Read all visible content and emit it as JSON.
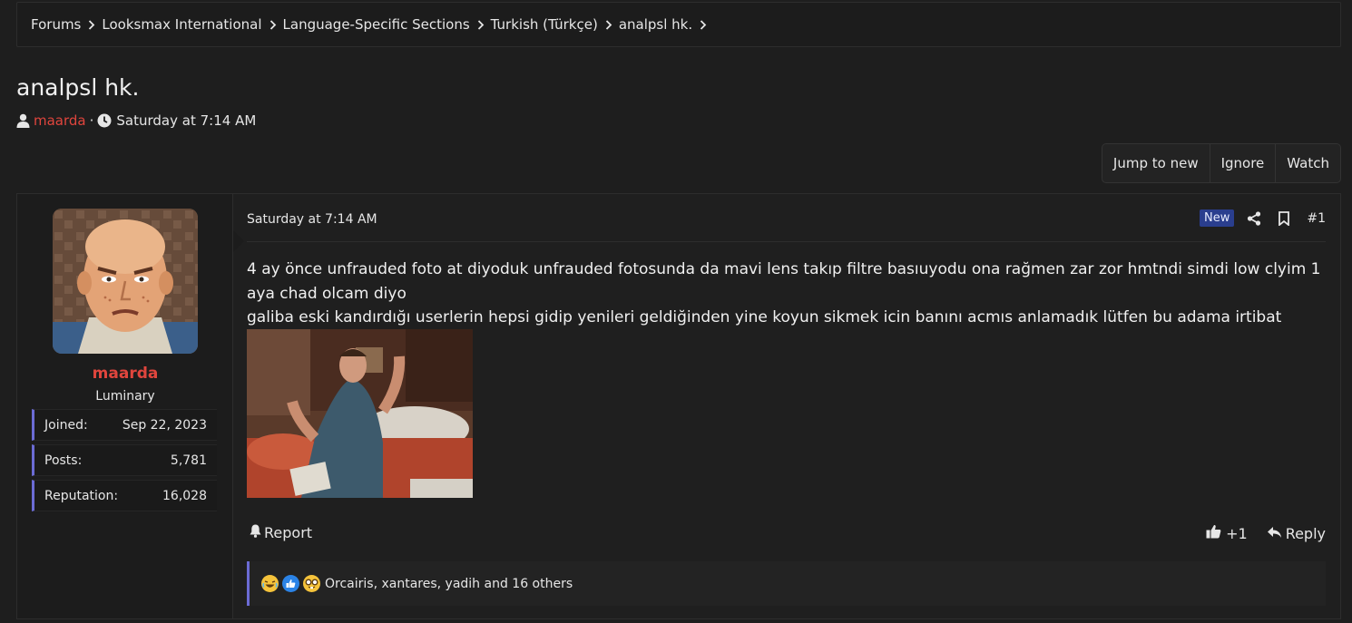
{
  "breadcrumb": {
    "items": [
      {
        "label": "Forums"
      },
      {
        "label": "Looksmax International"
      },
      {
        "label": "Language-Specific Sections"
      },
      {
        "label": "Turkish (Türkçe)"
      },
      {
        "label": "analpsl hk."
      }
    ]
  },
  "thread": {
    "title": "analpsl hk.",
    "author": "maarda",
    "meta_separator": "·",
    "date": "Saturday at 7:14 AM"
  },
  "actions": {
    "jump_to_new": "Jump to new",
    "ignore": "Ignore",
    "watch": "Watch"
  },
  "user": {
    "name": "maarda",
    "title": "Luminary",
    "stats": [
      {
        "label": "Joined:",
        "value": "Sep 22, 2023"
      },
      {
        "label": "Posts:",
        "value": "5,781"
      },
      {
        "label": "Reputation:",
        "value": "16,028"
      }
    ]
  },
  "post": {
    "date": "Saturday at 7:14 AM",
    "badge": "New",
    "number": "#1",
    "body_lines": [
      "4 ay önce unfrauded foto at diyoduk unfrauded fotosunda da mavi lens takıp filtre basıuyodu ona rağmen zar zor hmtndi simdi low clyim 1 aya chad olcam diyo",
      "galiba eski kandırdığı userlerin hepsi gidip yenileri geldiğinden yine koyun sikmek icin banını acmıs anlamadık lütfen bu adama irtibat etmeyiniz"
    ],
    "report_label": "Report",
    "like_count": "+1",
    "reply_label": "Reply",
    "reactions_text": "Orcairis, xantares, yadih and 16 others"
  },
  "colors": {
    "background": "#1e1e1e",
    "username": "#e0453d",
    "accent_bar": "#6b6bd4",
    "badge": "#2a3e8e"
  },
  "icons": [
    "chevron-right-icon",
    "user-icon",
    "clock-icon",
    "share-icon",
    "bookmark-icon",
    "bell-icon",
    "thumbs-up-icon",
    "reply-icon",
    "laugh-cry-emoji",
    "like-emoji",
    "nerd-emoji"
  ]
}
